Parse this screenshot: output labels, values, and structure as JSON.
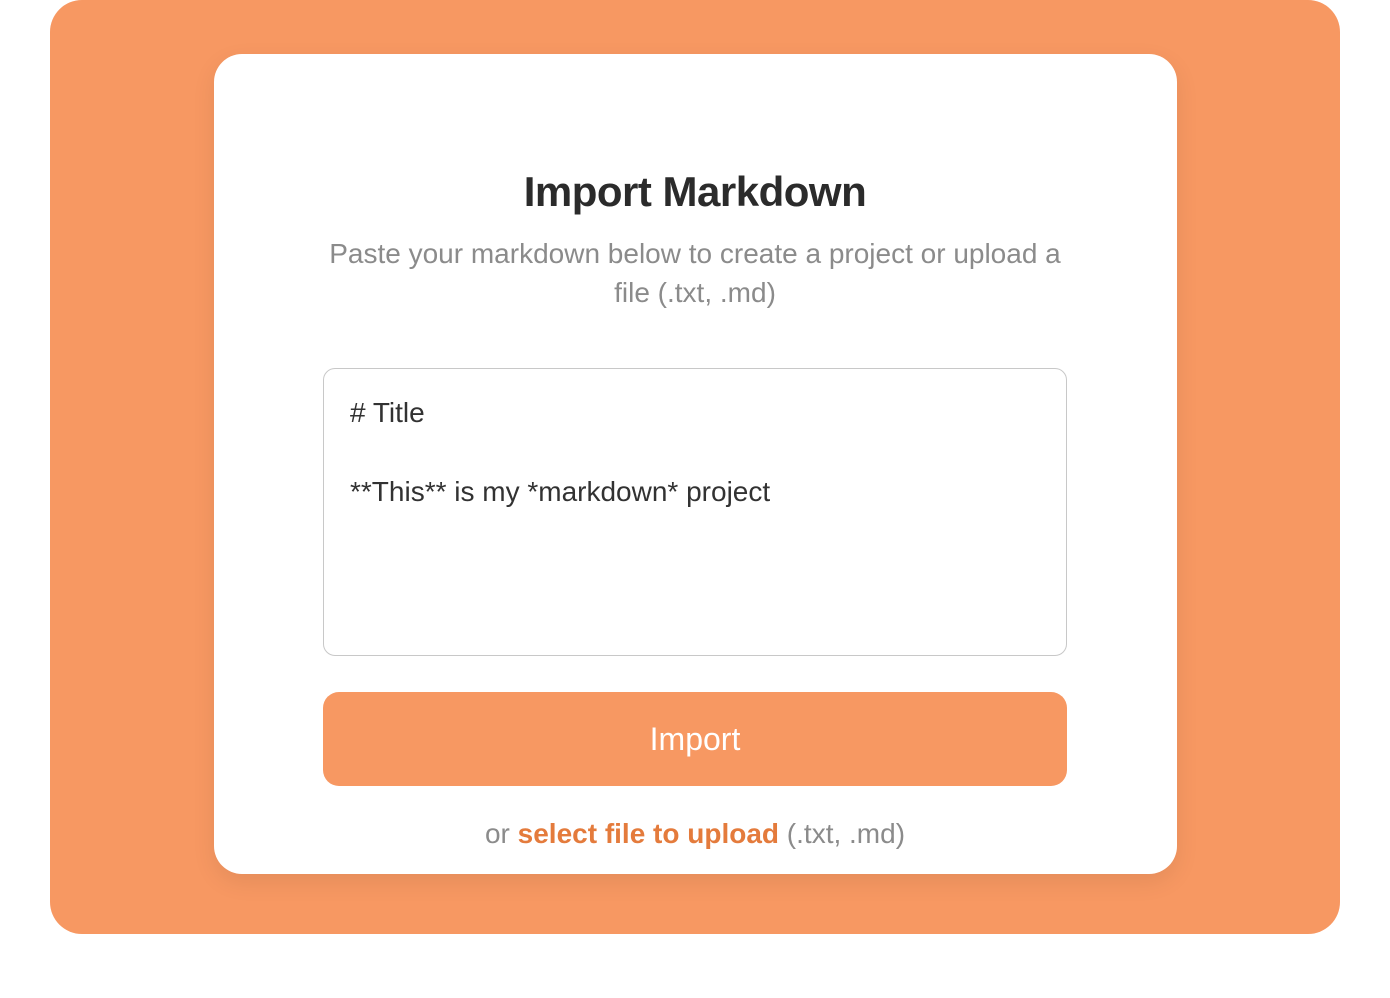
{
  "modal": {
    "title": "Import Markdown",
    "subtitle": "Paste your markdown below to create a project or upload a file (.txt, .md)",
    "textarea_placeholder": "# Title\n\n**This** is my *markdown* project",
    "textarea_value": "",
    "import_button_label": "Import",
    "upload_prefix": "or ",
    "upload_link_label": "select file to upload",
    "upload_hint": " (.txt, .md)"
  },
  "colors": {
    "accent": "#f79862",
    "accent_dark": "#e47b3c",
    "text_primary": "#2b2b2b",
    "text_secondary": "#8b8b8b",
    "border": "#c8c8c8",
    "white": "#ffffff"
  }
}
